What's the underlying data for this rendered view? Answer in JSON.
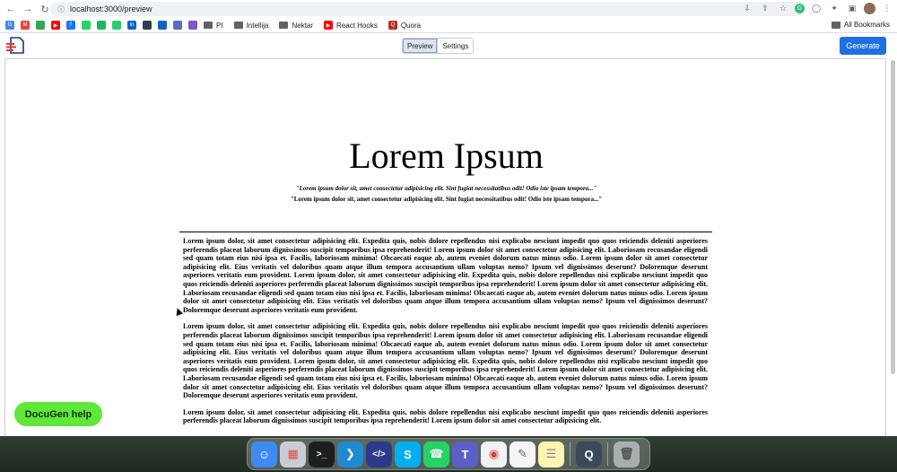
{
  "browser": {
    "url": "localhost:3000/preview",
    "bookmarks": [
      {
        "label": "PI"
      },
      {
        "label": "Intellija"
      },
      {
        "label": "Nektar"
      },
      {
        "label": "React Hooks"
      },
      {
        "label": "Quora"
      }
    ],
    "all_bookmarks": "All Bookmarks"
  },
  "app": {
    "tabs": [
      {
        "label": "Preview",
        "active": true
      },
      {
        "label": "Settings",
        "active": false
      }
    ],
    "generate_label": "Generate",
    "help_label": "DocuGen help"
  },
  "document": {
    "title": "Lorem Ipsum",
    "quote_italic": "\"Lorem ipsum dolor sit, amet consectetur adipisicing elit. Sint fugiat necessitatibus odit! Odio iste ipsam tempora...\"",
    "quote_plain": "\"Lorem ipsum dolor sit, amet consectetur adipisicing elit. Sint fugiat necessitatibus odit! Odio iste ipsam tempora...\"",
    "paragraphs": [
      "Lorem ipsum dolor, sit amet consectetur adipisicing elit. Expedita quis, nobis dolore repellendus nisi explicabo nesciunt impedit quo quos reiciendis deleniti asperiores perferendis placeat laborum dignissimos suscipit temporibus ipsa reprehenderit! Lorem ipsum dolor sit amet consectetur adipisicing elit. Laboriosam recusandae eligendi sed quam totam eius nisi ipsa et. Facilis, laboriosam minima! Obcaecati eaque ab, autem eveniet dolorum natus minus odio. Lorem ipsum dolor sit amet consectetur adipisicing elit. Eius veritatis vel doloribus quam atque illum tempora accusantium ullam voluptas nemo? Ipsum vel dignissimos deserunt? Doloremque deserunt asperiores veritatis eum provident. Lorem ipsum dolor, sit amet consectetur adipisicing elit. Expedita quis, nobis dolore repellendus nisi explicabo nesciunt impedit quo quos reiciendis deleniti asperiores perferendis placeat laborum dignissimos suscipit temporibus ipsa reprehenderit! Lorem ipsum dolor sit amet consectetur adipisicing elit. Laboriosam recusandae eligendi sed quam totam eius nisi ipsa et. Facilis, laboriosam minima! Obcaecati eaque ab, autem eveniet dolorum natus minus odio. Lorem ipsum dolor sit amet consectetur adipisicing elit. Eius veritatis vel doloribus quam atque illum tempora accusantium ullam voluptas nemo? Ipsum vel dignissimos deserunt? Doloremque deserunt asperiores veritatis eum provident.",
      "Lorem ipsum dolor, sit amet consectetur adipisicing elit. Expedita quis, nobis dolore repellendus nisi explicabo nesciunt impedit quo quos reiciendis deleniti asperiores perferendis placeat laborum dignissimos suscipit temporibus ipsa reprehenderit! Lorem ipsum dolor sit amet consectetur adipisicing elit. Laboriosam recusandae eligendi sed quam totam eius nisi ipsa et. Facilis, laboriosam minima! Obcaecati eaque ab, autem eveniet dolorum natus minus odio. Lorem ipsum dolor sit amet consectetur adipisicing elit. Eius veritatis vel doloribus quam atque illum tempora accusantium ullam voluptas nemo? Ipsum vel dignissimos deserunt? Doloremque deserunt asperiores veritatis eum provident. Lorem ipsum dolor, sit amet consectetur adipisicing elit. Expedita quis, nobis dolore repellendus nisi explicabo nesciunt impedit quo quos reiciendis deleniti asperiores perferendis placeat laborum dignissimos suscipit temporibus ipsa reprehenderit! Lorem ipsum dolor sit amet consectetur adipisicing elit. Laboriosam recusandae eligendi sed quam totam eius nisi ipsa et. Facilis, laboriosam minima! Obcaecati eaque ab, autem eveniet dolorum natus minus odio. Lorem ipsum dolor sit amet consectetur adipisicing elit. Eius veritatis vel doloribus quam atque illum tempora accusantium ullam voluptas nemo? Ipsum vel dignissimos deserunt? Doloremque deserunt asperiores veritatis eum provident.",
      "Lorem ipsum dolor, sit amet consectetur adipisicing elit. Expedita quis, nobis dolore repellendus nisi explicabo nesciunt impedit quo quos reiciendis deleniti asperiores perferendis placeat laborum dignissimos suscipit temporibus ipsa reprehenderit! Lorem ipsum dolor sit amet consectetur adipisicing elit."
    ]
  },
  "colors": {
    "generate_button": "#1f6fe0",
    "help_button": "#5fe83a"
  }
}
